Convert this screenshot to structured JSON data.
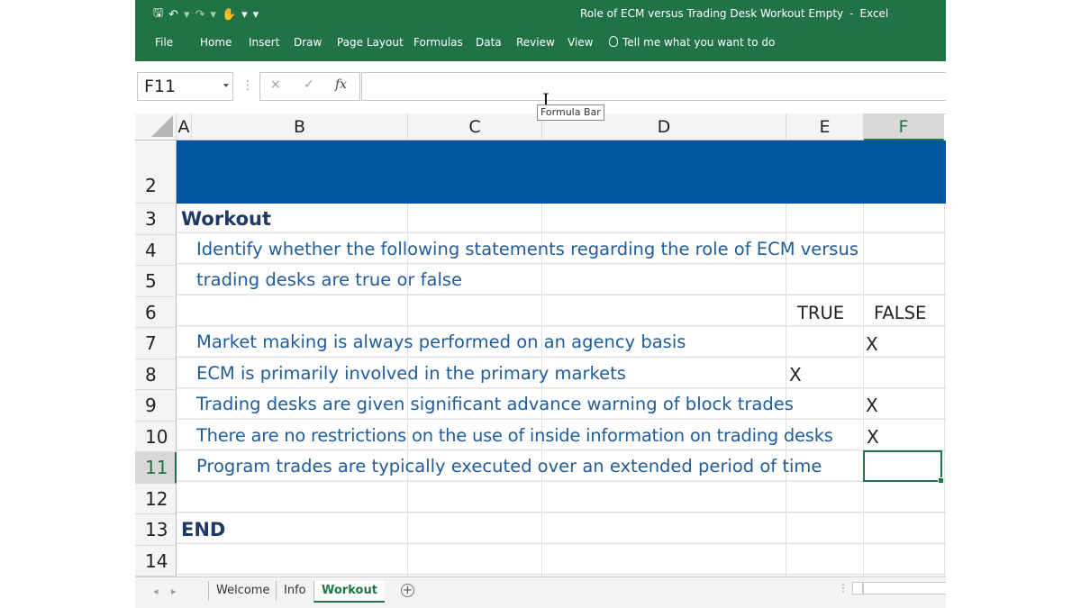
{
  "window": {
    "title_doc": "Role of ECM versus Trading Desk Workout Empty",
    "title_sep": "-",
    "title_app": "Excel"
  },
  "qat": {
    "save_icon": "floppy-disk-icon",
    "undo_icon": "undo-icon",
    "redo_icon": "redo-icon",
    "touch_icon": "touch-mode-icon",
    "customize_icon": "customize-qat-icon"
  },
  "ribbon": {
    "tabs": [
      "File",
      "Home",
      "Insert",
      "Draw",
      "Page Layout",
      "Formulas",
      "Data",
      "Review",
      "View"
    ],
    "tell_me": "Tell me what you want to do"
  },
  "formula_bar": {
    "name_box": "F11",
    "cancel": "×",
    "enter": "✓",
    "fx": "fx",
    "value": "",
    "tooltip": "Formula Bar"
  },
  "columns": [
    "A",
    "B",
    "C",
    "D",
    "E",
    "F"
  ],
  "selected_column": "F",
  "rows": [
    "2",
    "3",
    "4",
    "5",
    "6",
    "7",
    "8",
    "9",
    "10",
    "11",
    "12",
    "13",
    "14"
  ],
  "selected_row": "11",
  "sheet": {
    "heading": "Workout",
    "instruction_line1": "Identify whether the following statements regarding the role of ECM versus",
    "instruction_line2": "trading desks are true or false",
    "true_label": "TRUE",
    "false_label": "FALSE",
    "statements": [
      {
        "text": "Market making is always performed on an agency basis",
        "true_mark": "",
        "false_mark": "X"
      },
      {
        "text": "ECM is primarily involved in the primary markets",
        "true_mark": "X",
        "false_mark": ""
      },
      {
        "text": "Trading desks are given significant advance warning of block trades",
        "true_mark": "",
        "false_mark": "X"
      },
      {
        "text": "There are no restrictions on the use of inside information on trading desks",
        "true_mark": "",
        "false_mark": "X"
      },
      {
        "text": "Program trades are typically executed over an extended period of time",
        "true_mark": "",
        "false_mark": ""
      }
    ],
    "end_label": "END",
    "band_color": "#0055A2"
  },
  "sheet_tabs": [
    {
      "label": "Welcome",
      "active": false
    },
    {
      "label": "Info",
      "active": false
    },
    {
      "label": "Workout",
      "active": true
    }
  ],
  "colors": {
    "excel_green": "#217346",
    "heading_text": "#1F3864",
    "body_text": "#1F5C9B"
  }
}
